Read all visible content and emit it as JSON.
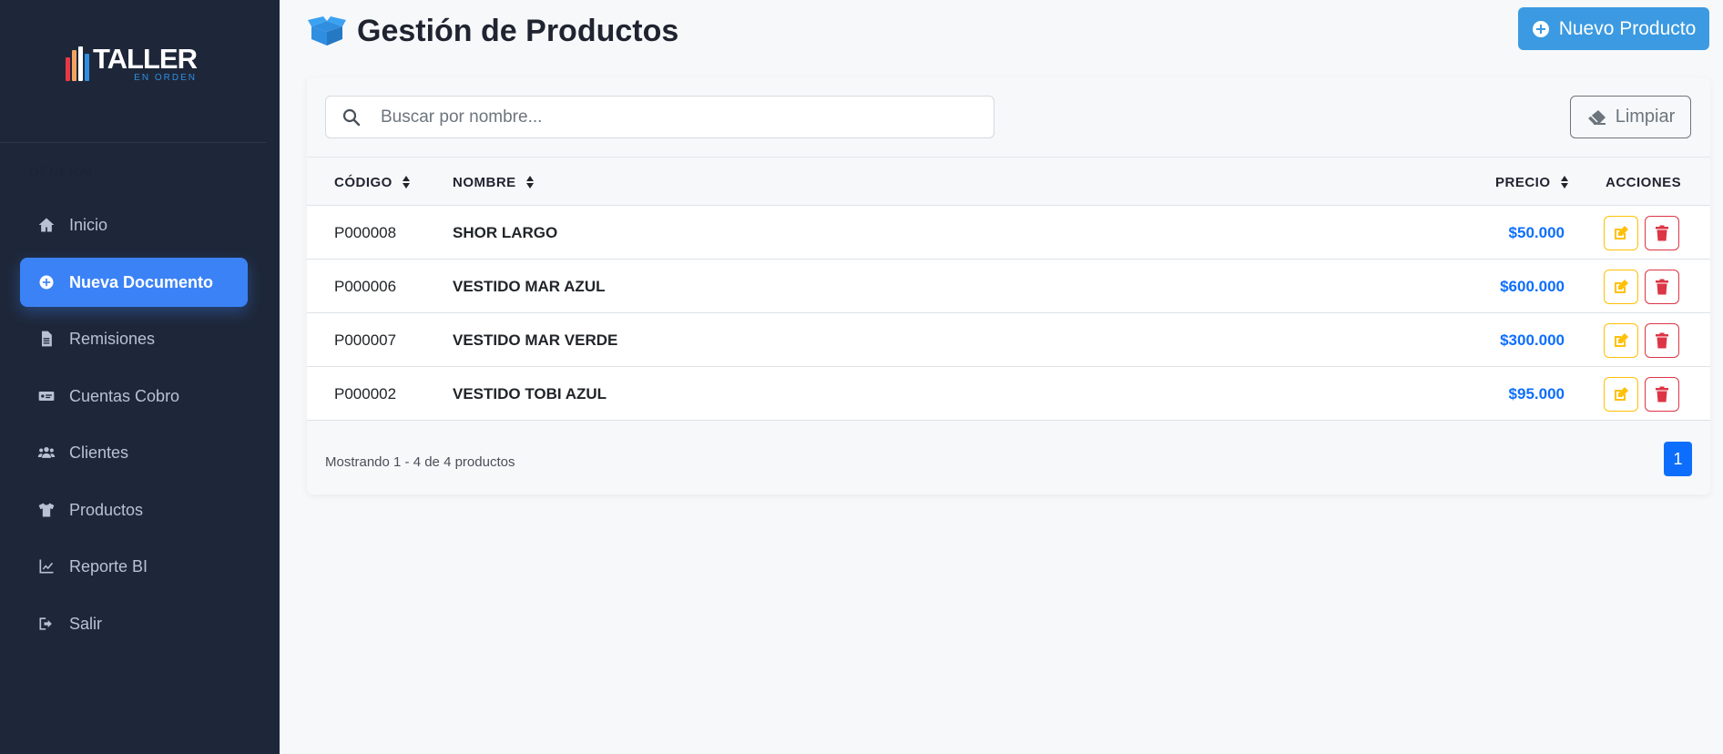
{
  "sidebar": {
    "logo": {
      "main": "TALLER",
      "sub": "EN ORDEN"
    },
    "menu_header": "GENERAL",
    "items": [
      {
        "label": "Inicio",
        "icon": "home-icon",
        "active": false
      },
      {
        "label": "Nueva Documento",
        "icon": "plus-circle-icon",
        "active": true
      },
      {
        "label": "Remisiones",
        "icon": "file-icon",
        "active": false
      },
      {
        "label": "Cuentas Cobro",
        "icon": "money-bill-icon",
        "active": false
      },
      {
        "label": "Clientes",
        "icon": "users-icon",
        "active": false
      },
      {
        "label": "Productos",
        "icon": "shirt-icon",
        "active": false
      },
      {
        "label": "Reporte BI",
        "icon": "line-chart-icon",
        "active": false
      },
      {
        "label": "Salir",
        "icon": "sign-out-icon",
        "active": false
      }
    ]
  },
  "header": {
    "title": "Gestión de Productos",
    "new_button_label": "Nuevo Producto"
  },
  "filters": {
    "search_placeholder": "Buscar por nombre...",
    "search_value": "",
    "clear_label": "Limpiar"
  },
  "table": {
    "columns": [
      "CÓDIGO",
      "NOMBRE",
      "PRECIO",
      "ACCIONES"
    ],
    "rows": [
      {
        "code": "P000008",
        "name": "SHOR LARGO",
        "price": "$50.000"
      },
      {
        "code": "P000006",
        "name": "VESTIDO MAR AZUL",
        "price": "$600.000"
      },
      {
        "code": "P000007",
        "name": "VESTIDO MAR VERDE",
        "price": "$300.000"
      },
      {
        "code": "P000002",
        "name": "VESTIDO TOBI AZUL",
        "price": "$95.000"
      }
    ]
  },
  "footer": {
    "summary": "Mostrando 1 - 4 de 4 productos",
    "current_page": "1"
  },
  "colors": {
    "sidebar_bg": "#1e2739",
    "active_item": "#3b82f6",
    "primary_button": "#3b9ae1",
    "price_text": "#0d6efd",
    "edit_accent": "#ffc107",
    "delete_accent": "#dc3545"
  }
}
